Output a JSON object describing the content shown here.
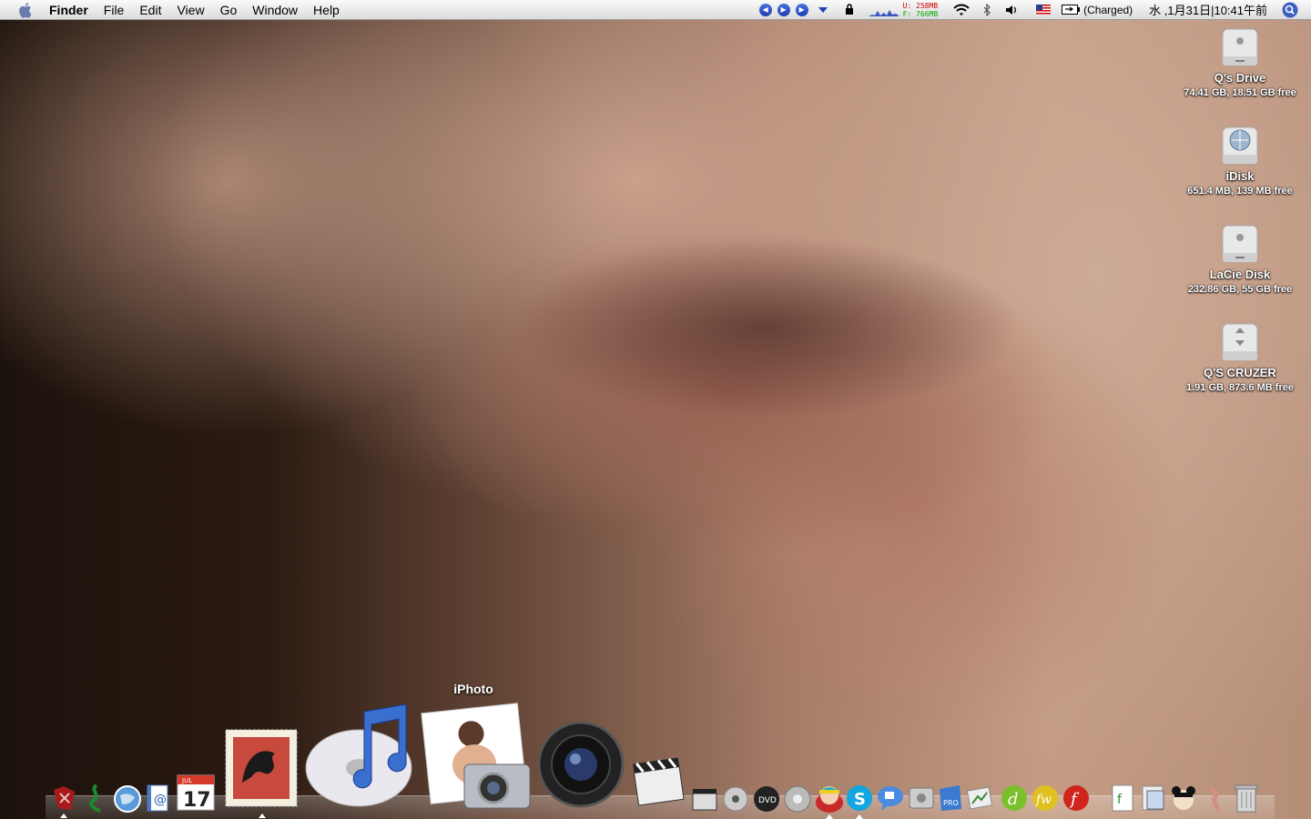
{
  "menubar": {
    "app_name": "Finder",
    "menus": [
      "File",
      "Edit",
      "View",
      "Go",
      "Window",
      "Help"
    ],
    "status": {
      "mem_used_label": "U:",
      "mem_used": "258MB",
      "mem_free_label": "F:",
      "mem_free": "766MB",
      "battery": "(Charged)",
      "clock": "水 ,1月31日|10:41午前"
    }
  },
  "desktop": {
    "drives": [
      {
        "name": "Q's Drive",
        "info": "74.41 GB, 18.51 GB free",
        "icon": "hard-drive-icon"
      },
      {
        "name": "iDisk",
        "info": "651.4 MB, 139 MB free",
        "icon": "idisk-icon"
      },
      {
        "name": "LaCie Disk",
        "info": "232.86 GB, 55 GB free",
        "icon": "hard-drive-icon"
      },
      {
        "name": "Q'S CRUZER",
        "info": "1.91 GB, 873.6 MB free",
        "icon": "usb-drive-icon"
      }
    ]
  },
  "dock": {
    "hover_label": "iPhoto",
    "calendar_month": "JUL",
    "calendar_day": "17",
    "colors": {
      "ical_red": "#d63a2a",
      "itunes_blue": "#3a6fd0",
      "flash_red": "#d0251c",
      "green_app": "#7ac02a"
    }
  }
}
